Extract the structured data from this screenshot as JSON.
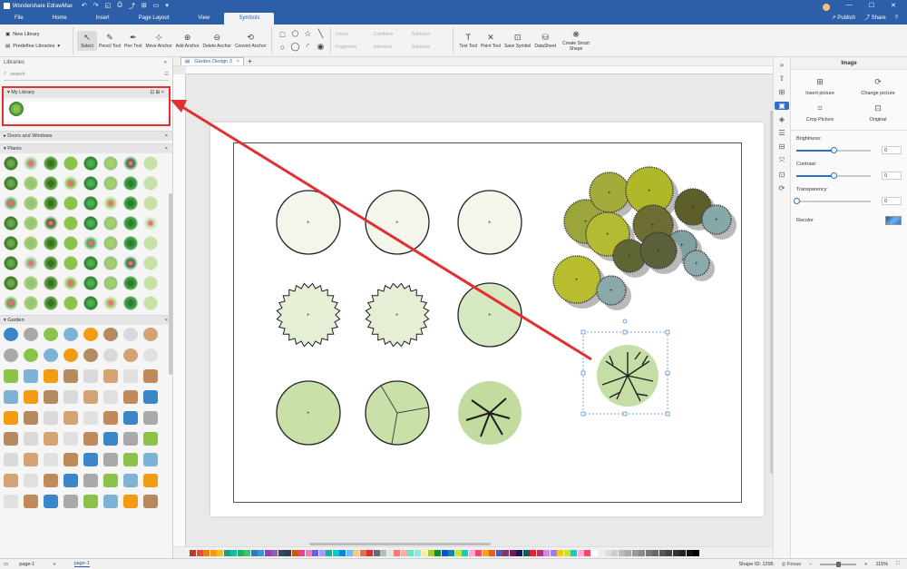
{
  "app": {
    "title": "Wondershare EdrawMax",
    "quick_access": [
      "↶",
      "↷",
      "◱",
      "⎙",
      "⤴",
      "⊞",
      "▭",
      "▾"
    ]
  },
  "window": {
    "min": "—",
    "max": "☐",
    "close": "✕"
  },
  "menu": {
    "tabs": [
      "File",
      "Home",
      "Insert",
      "Page Layout",
      "View",
      "Symbols"
    ],
    "active": "Symbols",
    "publish": "Publish",
    "share": "Share",
    "help": "?"
  },
  "ribbon": {
    "new_library": "New Library",
    "predefine_libraries": "Predefine Libraries",
    "tools": [
      {
        "icon": "↖",
        "label": "Select"
      },
      {
        "icon": "✎",
        "label": "Pencil Tool"
      },
      {
        "icon": "✒",
        "label": "Pen Tool"
      },
      {
        "icon": "⊹",
        "label": "Move Anchor"
      },
      {
        "icon": "⊕",
        "label": "Add Anchor"
      },
      {
        "icon": "⊖",
        "label": "Delete Anchor"
      },
      {
        "icon": "⟲",
        "label": "Convert Anchor"
      }
    ],
    "shapes": [
      "□",
      "⬠",
      "☆",
      "╲",
      "○",
      "◯",
      "◜",
      "◉"
    ],
    "boolean_ops": [
      "Union",
      "Combine",
      "Subtract",
      "Fragment",
      "Intersect",
      "Subtract"
    ],
    "tools2": [
      {
        "icon": "T",
        "label": "Text Tool"
      },
      {
        "icon": "✕",
        "label": "Point Tool"
      },
      {
        "icon": "⊡",
        "label": "Save Symbol"
      },
      {
        "icon": "⛁",
        "label": "DataSheet"
      },
      {
        "icon": "❋",
        "label": "Create Smart Shape"
      }
    ]
  },
  "left_panel": {
    "header": "Libraries",
    "search_placeholder": "search",
    "sections": {
      "my_library": "My Library",
      "doors": "Doors and Windows",
      "plants": "Plants",
      "garden": "Garden"
    }
  },
  "document": {
    "tab": "Garden Design 3",
    "close": "×",
    "add": "+"
  },
  "right_panel": {
    "title": "Image",
    "insert_picture": "Insert picture",
    "change_picture": "Change picture",
    "crop_picture": "Crop Picture",
    "original": "Original",
    "brightness_label": "Brightness:",
    "brightness_value": "0",
    "brightness_level": 0.5,
    "contrast_label": "Contrast:",
    "contrast_value": "0",
    "contrast_level": 0.5,
    "transparency_label": "Transparency:",
    "transparency_value": "0",
    "transparency_level": 0.0,
    "recolor_label": "Recolor"
  },
  "side_icons": [
    "⇧",
    "⊞",
    "▣",
    "◈",
    "☰",
    "⊟",
    "⤧",
    "⊡",
    "⟳"
  ],
  "status": {
    "page_name": "page-1",
    "add_page": "+",
    "active_page": "page-1",
    "shape_id": "Shape ID: 1295",
    "focus": "Focus",
    "zoom": "115%"
  },
  "colors": {
    "brand": "#2d5fa8",
    "highlight": "#e03030",
    "selection": "#2d6fc8"
  },
  "palette": [
    "#c0392b",
    "#e74c3c",
    "#e67e22",
    "#f39c12",
    "#f1c40f",
    "#16a085",
    "#1abc9c",
    "#27ae60",
    "#2ecc71",
    "#2980b9",
    "#3498db",
    "#8e44ad",
    "#9b59b6",
    "#34495e",
    "#2c3e50",
    "#d35400",
    "#e84393",
    "#fd79a8",
    "#6c5ce7",
    "#a29bfe",
    "#00b894",
    "#00cec9",
    "#0984e3",
    "#74b9ff",
    "#fdcb6e",
    "#e17055",
    "#d63031",
    "#636e72",
    "#b2bec3",
    "#dfe6e9",
    "#ff7675",
    "#fab1a0",
    "#55efc4",
    "#81ecec",
    "#ffeaa7",
    "#a3cb38",
    "#009432",
    "#0652dd",
    "#1289a7",
    "#c4e538",
    "#12cbc4",
    "#fda7df",
    "#ed4c67",
    "#f79f1f",
    "#ee5a24",
    "#5758bb",
    "#833471",
    "#6f1e51",
    "#1b1464",
    "#006266",
    "#ea2027",
    "#b53471",
    "#d980fa",
    "#9980fa",
    "#ffc312",
    "#c4e538",
    "#12cbc4",
    "#fda7df",
    "#ed4c67",
    "#ffffff",
    "#eeeeee",
    "#dddddd",
    "#cccccc",
    "#bbbbbb",
    "#aaaaaa",
    "#999999",
    "#888888",
    "#777777",
    "#666666",
    "#555555",
    "#444444",
    "#333333",
    "#222222",
    "#111111",
    "#000000"
  ]
}
